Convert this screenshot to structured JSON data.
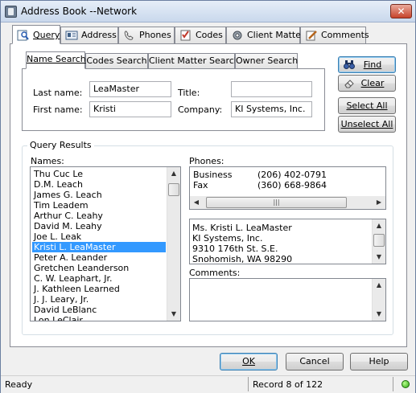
{
  "window": {
    "title": "Address Book --Network",
    "close": "✕"
  },
  "tabs": [
    {
      "label": "Query",
      "icon": "magnifier-icon"
    },
    {
      "label": "Address",
      "icon": "address-card-icon"
    },
    {
      "label": "Phones",
      "icon": "phone-icon"
    },
    {
      "label": "Codes",
      "icon": "checklist-icon"
    },
    {
      "label": "Client Matter",
      "icon": "gear-icon"
    },
    {
      "label": "Comments",
      "icon": "pencil-icon"
    }
  ],
  "search_tabs": [
    "Name Search",
    "Codes Search",
    "Client Matter Search",
    "Owner Search"
  ],
  "fields": {
    "last_name_label": "Last name:",
    "last_name_value": "LeaMaster",
    "title_label": "Title:",
    "title_value": "",
    "first_name_label": "First name:",
    "first_name_value": "Kristi",
    "company_label": "Company:",
    "company_value": "KI Systems, Inc."
  },
  "buttons": {
    "find": "Find",
    "clear": "Clear",
    "select_all": "Select All",
    "unselect_all": "Unselect All",
    "ok": "OK",
    "cancel": "Cancel",
    "help": "Help"
  },
  "results": {
    "group_title": "Query Results",
    "names_label": "Names:",
    "names": [
      "Thu Cuc Le",
      "D.M. Leach",
      "James G. Leach",
      "Tim Leadem",
      "Arthur C. Leahy",
      "David M. Leahy",
      "Joe L. Leak",
      "Kristi L. LeaMaster",
      "Peter A. Leander",
      "Gretchen Leanderson",
      "C. W. Leaphart, Jr.",
      "J. Kathleen Learned",
      "J. J. Leary, Jr.",
      "David LeBlanc",
      "Lon LeClair"
    ],
    "selected_index": 7,
    "phones_label": "Phones:",
    "phones": [
      {
        "type": "Business",
        "number": "(206) 402-0791"
      },
      {
        "type": "Fax",
        "number": "(360) 668-9864"
      }
    ],
    "address_lines": [
      "Ms. Kristi L. LeaMaster",
      "KI Systems, Inc.",
      "9310 176th St. S.E.",
      "Snohomish, WA  98290"
    ],
    "comments_label": "Comments:",
    "comments": ""
  },
  "status": {
    "state": "Ready",
    "record": "Record 8 of 122"
  }
}
